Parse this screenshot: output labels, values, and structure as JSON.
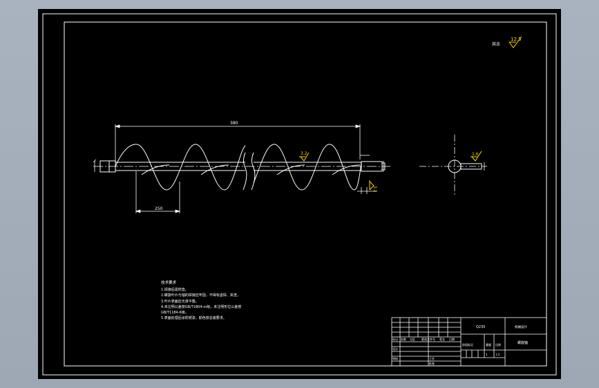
{
  "colors": {
    "background": "#000000",
    "line": "#ffffff",
    "roughness_symbol": "#ffd700",
    "window_chrome": "#a8b2be"
  },
  "dimensions": {
    "overall_length": "380",
    "pitch": "250"
  },
  "roughness": {
    "default": "12.5",
    "flight": "3.2",
    "shaft_end": "3.2",
    "section": "1.6"
  },
  "notes_block": {
    "heading": "技术要求",
    "lines": [
      "1.焊接后需校直。",
      "2.螺旋叶片与轴的焊接应牢固，不得有虚焊、夹渣。",
      "3.叶片表面应光滑平整。",
      "4.未注明公差按GB/T1804-m级，未注明形位公差按",
      "GB/T1184-K级。",
      "5.表面处理后涂防锈漆，颜色按总装要求。"
    ]
  },
  "title_block": {
    "part_name": "螺旋轴",
    "drawing_no": "",
    "material": "Q235",
    "scale": "1:2",
    "sheet": "1",
    "header_cells": [
      "标记",
      "处数",
      "分区",
      "更改文件号",
      "签名",
      "日期"
    ],
    "label_stage": "阶段标记",
    "label_weight": "重量",
    "label_scale": "比例",
    "label_designer": "设计",
    "label_reviewer": "审核",
    "label_process": "工艺",
    "label_approve": "批准",
    "label_company": "机械设计"
  }
}
